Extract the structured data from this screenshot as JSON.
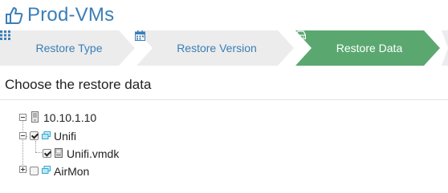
{
  "header": {
    "title": "Prod-VMs",
    "icon": "thumbs-up-icon"
  },
  "wizard": {
    "steps": [
      {
        "label": "Restore Type",
        "icon": "grid-icon",
        "active": false
      },
      {
        "label": "Restore Version",
        "icon": "calendar-icon",
        "active": false
      },
      {
        "label": "Restore Data",
        "icon": "hdd-icon",
        "active": true
      }
    ],
    "colors": {
      "inactive_bg": "#ececec",
      "active_bg": "#5aa870",
      "inactive_text": "#3a7eb7",
      "active_text": "#ffffff"
    }
  },
  "section": {
    "title": "Choose the restore data"
  },
  "tree": {
    "host": {
      "label": "10.10.1.10",
      "expanded": true,
      "icon": "server-icon"
    },
    "vms": [
      {
        "label": "Unifi",
        "checked": true,
        "expanded": true,
        "icon": "vm-icon",
        "disks": [
          {
            "label": "Unifi.vmdk",
            "checked": true,
            "icon": "disk-icon"
          }
        ]
      },
      {
        "label": "AirMon",
        "checked": false,
        "expanded": false,
        "icon": "vm-icon",
        "disks": []
      }
    ]
  }
}
